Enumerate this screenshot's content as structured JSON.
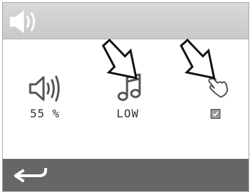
{
  "header": {
    "icon": "speaker-icon"
  },
  "settings": {
    "volume": {
      "icon": "volume-icon",
      "value": "55 %"
    },
    "tone": {
      "icon": "music-note-icon",
      "value": "LOW"
    },
    "touch_sound": {
      "icon": "touch-hand-icon",
      "checked": true
    }
  },
  "footer": {
    "icon": "back-arrow-icon"
  },
  "colors": {
    "header_bg": "#d0d0d0",
    "footer_bg": "#666666",
    "icon": "#555555"
  }
}
